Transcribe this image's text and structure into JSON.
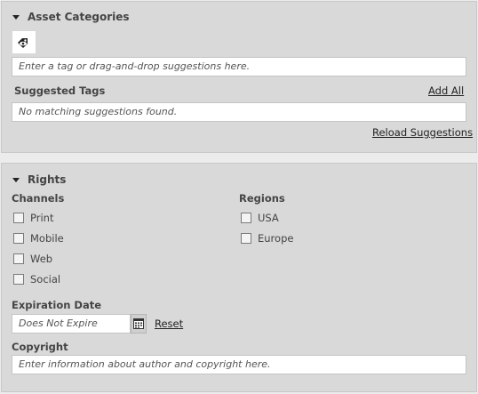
{
  "asset_categories": {
    "title": "Asset Categories",
    "icon": "tag-eye-icon",
    "tag_input_placeholder": "Enter a tag or drag-and-drop suggestions here.",
    "suggested_tags_label": "Suggested Tags",
    "add_all_label": "Add All",
    "suggestions_text": "No matching suggestions found.",
    "reload_label": "Reload Suggestions"
  },
  "rights": {
    "title": "Rights",
    "channels_label": "Channels",
    "channels": [
      "Print",
      "Mobile",
      "Web",
      "Social"
    ],
    "regions_label": "Regions",
    "regions": [
      "USA",
      "Europe"
    ],
    "expiration_label": "Expiration Date",
    "expiration_value": "Does Not Expire",
    "reset_label": "Reset",
    "copyright_label": "Copyright",
    "copyright_placeholder": "Enter information about author and copyright here."
  }
}
